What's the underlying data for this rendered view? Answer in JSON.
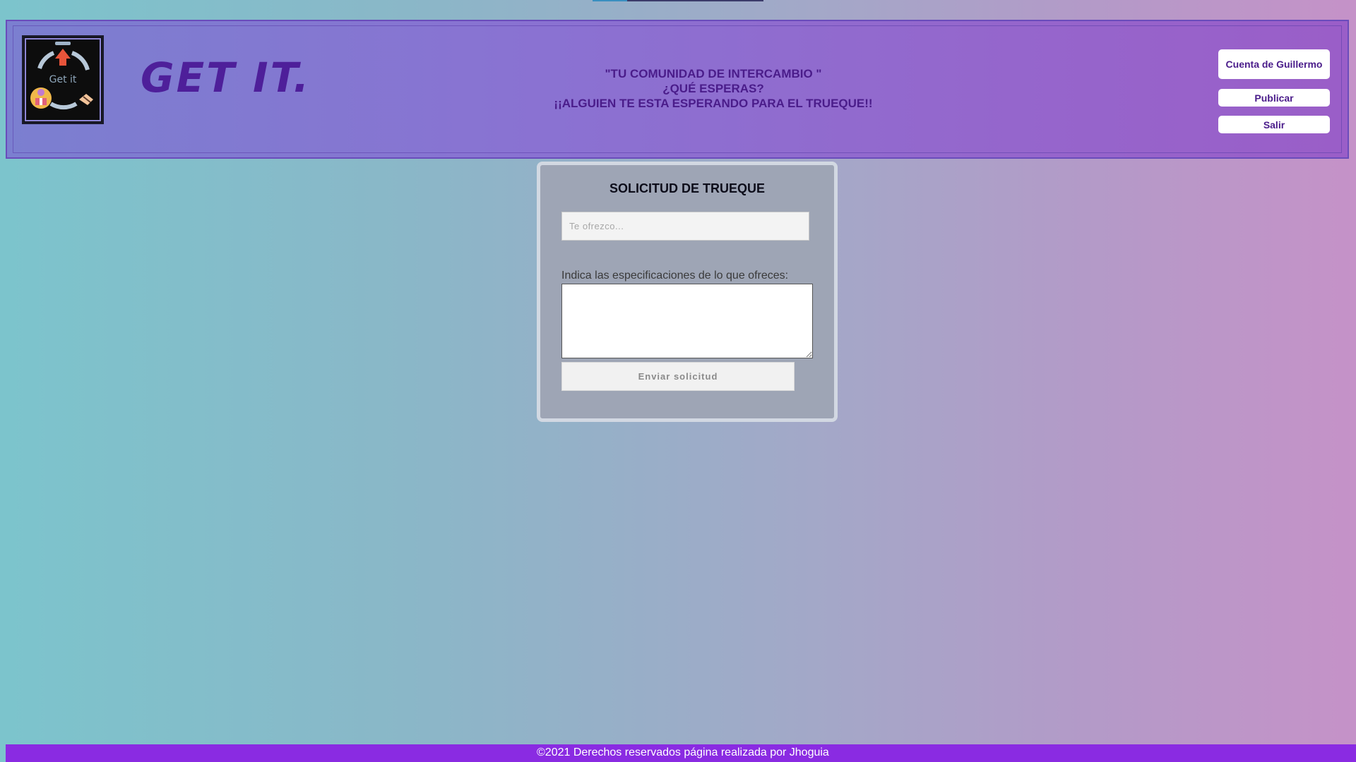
{
  "header": {
    "logo_text": "Get it",
    "brand": "GET IT.",
    "slogan": [
      "\"TU COMUNIDAD DE INTERCAMBIO \"",
      "¿QUÉ ESPERAS?",
      "¡¡ALGUIEN TE ESTA ESPERANDO PARA EL TRUEQUE!!"
    ],
    "buttons": {
      "account": "Cuenta de Guillermo",
      "publish": "Publicar",
      "exit": "Salir"
    }
  },
  "form": {
    "title": "SOLICITUD DE TRUEQUE",
    "offer_placeholder": "Te ofrezco...",
    "offer_value": "",
    "spec_label": "Indica las especificaciones de lo que ofreces:",
    "spec_value": "",
    "submit_label": "Enviar solicitud"
  },
  "footer": {
    "text": "©2021 Derechos reservados página realizada por Jhoguia"
  },
  "colors": {
    "header_text": "#4a1c8a",
    "footer_bg": "#8a2be2",
    "card_bg": "#9ea5b5"
  },
  "icons": {
    "logo": "get-it-logo",
    "logo_arrow": "up-arrow-icon",
    "logo_gift": "gift-icon",
    "logo_handshake": "handshake-icon"
  }
}
